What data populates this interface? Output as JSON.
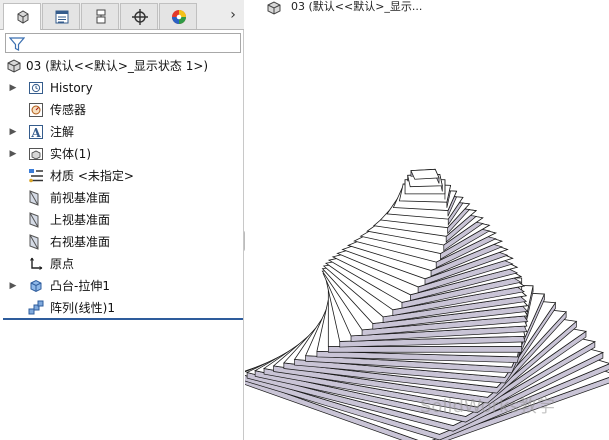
{
  "tabs": [
    {
      "name": "feature-manager",
      "icon": "feature-tree-icon"
    },
    {
      "name": "property-manager",
      "icon": "property-list-icon"
    },
    {
      "name": "configuration-manager",
      "icon": "configuration-icon"
    },
    {
      "name": "dimxpert-manager",
      "icon": "crosshair-icon"
    },
    {
      "name": "display-manager",
      "icon": "color-wheel-icon"
    }
  ],
  "tab_more": "›",
  "filter": {
    "placeholder": "",
    "icon": "funnel-icon"
  },
  "tree": {
    "root": {
      "label": "03  (默认<<默认>_显示状态 1>)",
      "icon": "part-icon"
    },
    "items": [
      {
        "label": "History",
        "icon": "history-icon",
        "expandable": true
      },
      {
        "label": "传感器",
        "icon": "sensor-icon",
        "expandable": false
      },
      {
        "label": "注解",
        "icon": "annotation-icon",
        "expandable": true
      },
      {
        "label": "实体(1)",
        "icon": "solid-bodies-icon",
        "expandable": true
      },
      {
        "label": "材质 <未指定>",
        "icon": "material-icon",
        "expandable": false
      },
      {
        "label": "前视基准面",
        "icon": "plane-icon",
        "expandable": false
      },
      {
        "label": "上视基准面",
        "icon": "plane-icon",
        "expandable": false
      },
      {
        "label": "右视基准面",
        "icon": "plane-icon",
        "expandable": false
      },
      {
        "label": "原点",
        "icon": "origin-icon",
        "expandable": false
      },
      {
        "label": "凸台-拉伸1",
        "icon": "boss-extrude-icon",
        "expandable": true
      },
      {
        "label": "阵列(线性)1",
        "icon": "linear-pattern-icon",
        "expandable": false
      }
    ]
  },
  "graphics": {
    "title": "03  (默认<<默认>_显示...",
    "title_icon": "part-icon",
    "watermark": "SolidWorks教学",
    "model": {
      "layers": 33,
      "twist_deg_per_layer": 4.5
    }
  },
  "colors": {
    "accent": "#2e5c9c",
    "edge": "#1a1a1a",
    "face_light": "#ffffff",
    "face_dark": "#c9c4d6"
  }
}
